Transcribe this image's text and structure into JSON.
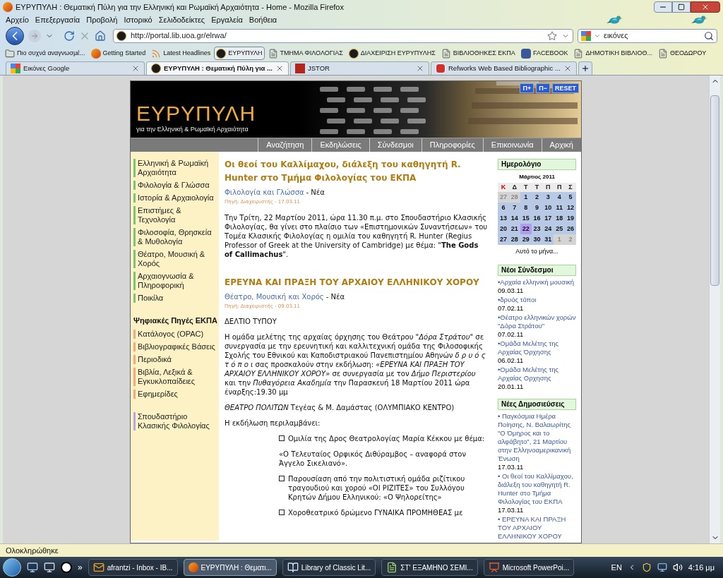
{
  "window": {
    "title": "ΕΥΡΥΠΥΛΗ : Θεματική Πύλη για την Ελληνική και Ρωμαϊκή Αρχαιότητα - Home - Mozilla Firefox"
  },
  "menu": [
    "Αρχείο",
    "Επεξεργασία",
    "Προβολή",
    "Ιστορικό",
    "Σελιδοδείκτες",
    "Εργαλεία",
    "Βοήθεια"
  ],
  "navigation": {
    "url": "http://portal.lib.uoa.gr/elrwa/",
    "search_value": "εικόνες"
  },
  "bookmarks": [
    {
      "label": "Πιο συχνά αναγνωσμέ...",
      "kind": "folder",
      "selected": false
    },
    {
      "label": "Getting Started",
      "kind": "firefox",
      "selected": false
    },
    {
      "label": "Latest Headlines",
      "kind": "feed",
      "selected": false
    },
    {
      "label": "ΕΥΡΥΠΥΛΗ",
      "kind": "site",
      "selected": true
    },
    {
      "label": "ΤΜΗΜΑ ΦΙΛΟΛΟΓΙΑΣ",
      "kind": "page",
      "selected": false
    },
    {
      "label": "ΔΙΑΧΕΙΡΙΣΗ ΕΥΡΥΠΥΛΗΣ",
      "kind": "site",
      "selected": false
    },
    {
      "label": "ΒΙΒΛΙΟΘΗΚΕΣ ΕΚΠΑ",
      "kind": "page",
      "selected": false
    },
    {
      "label": "FACEBOOK",
      "kind": "facebook",
      "selected": false
    },
    {
      "label": "ΔΗΜΟΤΙΚΗ ΒΙΒΛΙΟΘ...",
      "kind": "page",
      "selected": false
    },
    {
      "label": "ΘΕΟΔΩΡΟΥ",
      "kind": "page",
      "selected": false
    }
  ],
  "tabs": [
    {
      "label": "Εικόνες Google",
      "kind": "google",
      "selected": false
    },
    {
      "label": "ΕΥΡΥΠΥΛΗ : Θεματική Πύλη για ...",
      "kind": "site",
      "selected": true
    },
    {
      "label": "JSTOR",
      "kind": "jstor",
      "selected": false
    },
    {
      "label": "Refworks Web Based Bibliographic ...",
      "kind": "refworks",
      "selected": false
    }
  ],
  "page": {
    "logo": {
      "title": "ΕΥΡΥΠΥΛΗ",
      "subtitle": "για την Ελληνική & Ρωμαϊκή Αρχαιότητα"
    },
    "zoom_buttons": [
      "Π+",
      "Π−",
      "RESET"
    ],
    "nav": [
      "Αναζήτηση",
      "Εκδηλώσεις",
      "Σύνδεσμοι",
      "Πληροφορίες",
      "Επικοινωνία",
      "Αρχική"
    ],
    "sidebar": [
      {
        "color": "#7cc576",
        "items": [
          "Ελληνική & Ρωμαϊκή Αρχαιότητα",
          "Φιλολογία & Γλώσσα",
          "Ιστορία & Αρχαιολογία",
          "Επιστήμες & Τεχνολογία",
          "Φιλοσοφία, Θρησκεία & Μυθολογία",
          "Θέατρο, Μουσική & Χορός",
          "Αρχαιογνωσία & Πληροφορική",
          "Ποικίλα"
        ]
      },
      {
        "heading": "Ψηφιακές Πηγές ΕΚΠΑ",
        "color": "#f4a97a",
        "items": [
          "Κατάλογος (OPAC)",
          "Βιβλιογραφικές Βάσεις",
          "Περιοδικά",
          "Βιβλία, Λεξικά & Εγκυκλοπαίδειες",
          "Εφημερίδες"
        ]
      },
      {
        "color": "#b9a6e0",
        "items": [
          "Σπουδαστήριο Κλασικής Φιλολογίας"
        ]
      }
    ],
    "articles": [
      {
        "title": "Οι θεοί του Καλλίμαχου, διάλεξη του καθηγητή R. Hunter στο Τμήμα Φιλολογίας του ΕΚΠΑ",
        "category": "Φιλολογία και Γλώσσα",
        "section": "- Νέα",
        "source": "Πηγή: Διαχειριστής - 17.03.11",
        "blocks": [
          {
            "kind": "paragraph",
            "text": "Την Τρίτη, 22 Μαρτίου 2011, ώρα 11.30 π.μ. στο Σπουδαστήριο Κλασικής Φιλολογίας, θα γίνει στο πλαίσιο των «Επιστημονικών Συναντήσεων» του Τομέα Κλασικής Φιλολογίας η ομιλία του καθηγητή R. Hunter (Regius Professor of Greek at the University of Cambridge) με θέμα: \"**The Gods of Callimachus**\"."
          }
        ]
      },
      {
        "title": "ΕΡΕΥΝΑ ΚΑΙ ΠΡΑΞΗ ΤΟΥ ΑΡΧΑΙΟΥ ΕΛΛΗΝΙΚΟΥ ΧΟΡΟΥ",
        "category": "Θέατρο, Μουσική και Χορός",
        "section": "- Νέα",
        "source": "Πηγή: Διαχειριστής - 09.03.11",
        "blocks": [
          {
            "kind": "paragraph",
            "text": "ΔΕΛΤΙΟ ΤΥΠΟΥ"
          },
          {
            "kind": "paragraph",
            "text": "Η ομάδα μελέτης της αρχαίας όρχησης του Θεάτρου \"*Δόρα Στράτου*\" σε συνεργασία με την ερευνητική και καλλιτεχνική ομάδα της Φιλοσοφικής Σχολής  του Εθνικού και Καποδιστριακού Πανεπιστημίου Αθηνών *δ ρ υ ό ς   τ ό π ο ι* σας προσκαλούν στην εκδήλωση: *«ΕΡΕΥΝΑ ΚΑΙ ΠΡΑΞΗ ΤΟΥ ΑΡΧΑΙΟΥ ΕΛΛΗΝΙΚΟΥ ΧΟΡΟΥ»* σε συνεργασία με τον *Δήμο Περιστερίου* και την *Πυθαγόρεια Ακαδημία* την Παρασκευή 18 Μαρτίου 2011  ώρα έναρξης:19.30 μμ"
          },
          {
            "kind": "paragraph",
            "text": "*ΘΕΑΤΡΟ ΠΟΛΙΤΩΝ* Τεγέας & Μ. Δαμάστας (ΟΛΥΜΠΙΑΚΟ ΚΕΝΤΡΟ)"
          },
          {
            "kind": "paragraph",
            "text": "Η εκδήλωση περιλαμβάνει:"
          },
          {
            "kind": "bullet",
            "text": "Ομιλία της Δρος Θεατρολογίας Μαρία Κέκκου με θέμα:"
          },
          {
            "kind": "note",
            "text": "«Ο Τελευταίος Ορφικός Διθύραμβος – αναφορά στον Άγγελο Σικελιανό»."
          },
          {
            "kind": "bullet",
            "text": "Παρουσίαση από την πολιτιστική ομάδα ριζίτικου τραγουδιού και χορού   «ΟΙ ΡΙΖΙΤΕΣ» του Συλλόγου Κρητών Δήμου Ελληνικού: «Ο Ψηλορείτης»"
          },
          {
            "kind": "bullet",
            "text": "Χοροθεατρικό δρώμενο  ΓΥΝΑΙΚΑ ΠΡΟΜΗΘΕΑΣ με"
          }
        ]
      }
    ],
    "calendar": {
      "heading": "Ημερολόγιο",
      "month": "Μάρτιος 2011",
      "weekdays": [
        {
          "label": "Κ",
          "kind": "holiday"
        },
        {
          "label": "Δ",
          "kind": "workday"
        },
        {
          "label": "Τ",
          "kind": "workday"
        },
        {
          "label": "Τ",
          "kind": "workday"
        },
        {
          "label": "Π",
          "kind": "workday"
        },
        {
          "label": "Π",
          "kind": "workday"
        },
        {
          "label": "Σ",
          "kind": "workday"
        }
      ],
      "weeks": [
        [
          {
            "day": "27",
            "outside": true,
            "selected": false
          },
          {
            "day": "28",
            "outside": true,
            "selected": false
          },
          {
            "day": "1",
            "outside": false,
            "selected": false
          },
          {
            "day": "2",
            "outside": false,
            "selected": false
          },
          {
            "day": "3",
            "outside": false,
            "selected": false
          },
          {
            "day": "4",
            "outside": false,
            "selected": false
          },
          {
            "day": "5",
            "outside": false,
            "selected": false
          }
        ],
        [
          {
            "day": "6",
            "outside": false,
            "selected": false
          },
          {
            "day": "7",
            "outside": false,
            "selected": false
          },
          {
            "day": "8",
            "outside": false,
            "selected": false
          },
          {
            "day": "9",
            "outside": false,
            "selected": false
          },
          {
            "day": "10",
            "outside": false,
            "selected": false
          },
          {
            "day": "11",
            "outside": false,
            "selected": false
          },
          {
            "day": "12",
            "outside": false,
            "selected": false
          }
        ],
        [
          {
            "day": "13",
            "outside": false,
            "selected": false
          },
          {
            "day": "14",
            "outside": false,
            "selected": false
          },
          {
            "day": "15",
            "outside": false,
            "selected": false
          },
          {
            "day": "16",
            "outside": false,
            "selected": false
          },
          {
            "day": "17",
            "outside": false,
            "selected": false
          },
          {
            "day": "18",
            "outside": false,
            "selected": false
          },
          {
            "day": "19",
            "outside": false,
            "selected": false
          }
        ],
        [
          {
            "day": "20",
            "outside": false,
            "selected": false
          },
          {
            "day": "21",
            "outside": false,
            "selected": false
          },
          {
            "day": "22",
            "outside": false,
            "selected": true
          },
          {
            "day": "23",
            "outside": false,
            "selected": false
          },
          {
            "day": "24",
            "outside": false,
            "selected": false
          },
          {
            "day": "25",
            "outside": false,
            "selected": false
          },
          {
            "day": "26",
            "outside": false,
            "selected": false
          }
        ],
        [
          {
            "day": "27",
            "outside": false,
            "selected": false
          },
          {
            "day": "28",
            "outside": false,
            "selected": false
          },
          {
            "day": "29",
            "outside": false,
            "selected": false
          },
          {
            "day": "30",
            "outside": false,
            "selected": false
          },
          {
            "day": "31",
            "outside": false,
            "selected": false
          },
          {
            "day": "1",
            "outside": true,
            "selected": false
          },
          {
            "day": "2",
            "outside": true,
            "selected": false
          }
        ]
      ],
      "more": "Αυτό το μήνα..."
    },
    "links": {
      "heading": "Νέοι Σύνδεσμοι",
      "items": [
        {
          "title": "•Αρχαία ελληνική μουσική",
          "date": "09.03.11"
        },
        {
          "title": "•δρυός τόποι",
          "date": "07.02.11"
        },
        {
          "title": "•Θέατρο ελληνικών χορών \"Δόρα Στράτου\"",
          "date": "07.02.11"
        },
        {
          "title": "•Ομάδα Μελέτης της Αρχαίας Όρχησης",
          "date": "06.02.11"
        },
        {
          "title": "•Ομάδα Μελέτης της Αρχαίας Ορχησης",
          "date": "20.01.11"
        }
      ]
    },
    "publications": {
      "heading": "Νέες Δημοσιεύσεις",
      "items": [
        {
          "title": "• Παγκόσμια Ημέρα Ποίησης, Ν. Βαλαωρίτης \"Ο Όμηρος και το αλφάβητο\", 21 Μαρτίου στην Ελληνοαμερικανική Ένωση",
          "date": "17.03.11"
        },
        {
          "title": "• Οι θεοί του Καλλίμαχου, διάλεξη του καθηγητή R. Hunter στο Τμήμα Φιλολογίας του ΕΚΠΑ",
          "date": "17.03.11"
        },
        {
          "title": "• ΕΡΕΥΝΑ ΚΑΙ ΠΡΑΞΗ ΤΟΥ ΑΡΧΑΙΟΥ ΕΛΛΗΝΙΚΟΥ ΧΟΡΟΥ"
        }
      ]
    }
  },
  "status": "Ολοκληρώθηκε",
  "taskbar": {
    "more": "»",
    "items": [
      {
        "label": "afrantzi - Inbox - IB...",
        "kind": "mail",
        "selected": false
      },
      {
        "label": "ΕΥΡΥΠΥΛΗ : Θεματι...",
        "kind": "firefox",
        "selected": true
      },
      {
        "label": "Library of Classic Lit...",
        "kind": "library",
        "selected": false
      },
      {
        "label": "ΣΤ' ΕΞΑΜΗΝΟ ΣΕΜΙ...",
        "kind": "document",
        "selected": false
      },
      {
        "label": "Microsoft PowerPoi...",
        "kind": "powerpoint",
        "selected": false
      }
    ],
    "language": "EN",
    "time": "4:16 μμ"
  }
}
